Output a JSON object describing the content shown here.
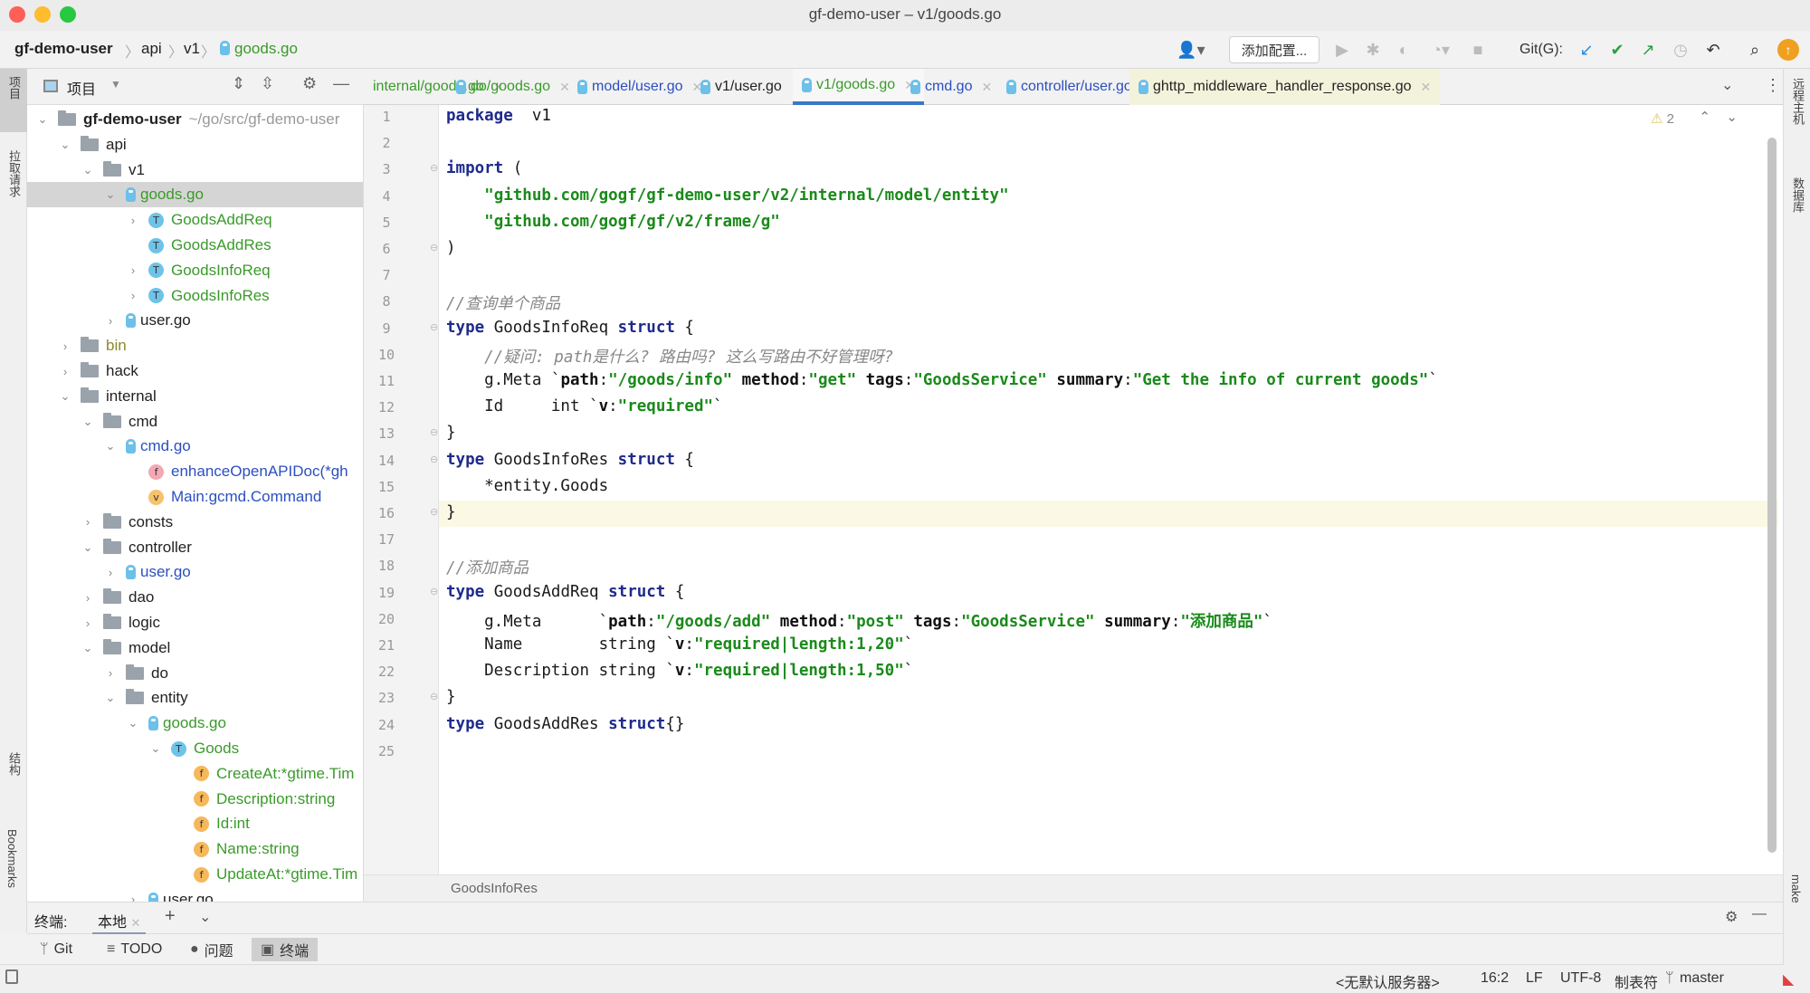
{
  "window": {
    "title": "gf-demo-user – v1/goods.go"
  },
  "navbar": {
    "breadcrumb": [
      "gf-demo-user",
      "api",
      "v1",
      "goods.go"
    ],
    "config_button": "添加配置...",
    "git_label": "Git(G):"
  },
  "left_strip": {
    "items": [
      "项目",
      "拉取请求",
      "结构",
      "Bookmarks"
    ]
  },
  "right_strip": {
    "items": [
      "远程主机",
      "数据库",
      "make"
    ]
  },
  "project": {
    "header_label": "项目",
    "tree": [
      {
        "depth": 0,
        "type": "folder",
        "expanded": true,
        "label": "gf-demo-user",
        "hint": "~/go/src/gf-demo-user",
        "bold": true
      },
      {
        "depth": 1,
        "type": "folder",
        "expanded": true,
        "label": "api"
      },
      {
        "depth": 2,
        "type": "folder",
        "expanded": true,
        "label": "v1"
      },
      {
        "depth": 3,
        "type": "gofile",
        "expanded": true,
        "label": "goods.go",
        "color": "green",
        "selected": true
      },
      {
        "depth": 4,
        "type": "T",
        "expanded": false,
        "label": "GoodsAddReq",
        "color": "green"
      },
      {
        "depth": 4,
        "type": "T",
        "label": "GoodsAddRes",
        "color": "green"
      },
      {
        "depth": 4,
        "type": "T",
        "expanded": false,
        "label": "GoodsInfoReq",
        "color": "green"
      },
      {
        "depth": 4,
        "type": "T",
        "expanded": false,
        "label": "GoodsInfoRes",
        "color": "green"
      },
      {
        "depth": 3,
        "type": "gofile",
        "expanded": false,
        "label": "user.go"
      },
      {
        "depth": 1,
        "type": "folder",
        "expanded": false,
        "label": "bin",
        "color": "olive"
      },
      {
        "depth": 1,
        "type": "folder",
        "expanded": false,
        "label": "hack"
      },
      {
        "depth": 1,
        "type": "folder",
        "expanded": true,
        "label": "internal"
      },
      {
        "depth": 2,
        "type": "folder",
        "expanded": true,
        "label": "cmd"
      },
      {
        "depth": 3,
        "type": "gofile",
        "expanded": true,
        "label": "cmd.go",
        "color": "blue"
      },
      {
        "depth": 4,
        "type": "f",
        "label": "enhanceOpenAPIDoc(*gh",
        "color": "blue"
      },
      {
        "depth": 4,
        "type": "v",
        "label": "Main:gcmd.Command",
        "color": "blue"
      },
      {
        "depth": 2,
        "type": "folder",
        "expanded": false,
        "label": "consts"
      },
      {
        "depth": 2,
        "type": "folder",
        "expanded": true,
        "label": "controller"
      },
      {
        "depth": 3,
        "type": "gofile",
        "expanded": false,
        "label": "user.go",
        "color": "blue"
      },
      {
        "depth": 2,
        "type": "folder",
        "expanded": false,
        "label": "dao"
      },
      {
        "depth": 2,
        "type": "folder",
        "expanded": false,
        "label": "logic"
      },
      {
        "depth": 2,
        "type": "folder",
        "expanded": true,
        "label": "model"
      },
      {
        "depth": 3,
        "type": "folder",
        "expanded": false,
        "label": "do"
      },
      {
        "depth": 3,
        "type": "folder",
        "expanded": true,
        "label": "entity"
      },
      {
        "depth": 4,
        "type": "gofile",
        "expanded": true,
        "label": "goods.go",
        "color": "green"
      },
      {
        "depth": 5,
        "type": "T",
        "expanded": true,
        "label": "Goods",
        "color": "green"
      },
      {
        "depth": 6,
        "type": "fo",
        "label": "CreateAt:*gtime.Tim",
        "color": "green"
      },
      {
        "depth": 6,
        "type": "fo",
        "label": "Description:string",
        "color": "green"
      },
      {
        "depth": 6,
        "type": "fo",
        "label": "Id:int",
        "color": "green"
      },
      {
        "depth": 6,
        "type": "fo",
        "label": "Name:string",
        "color": "green"
      },
      {
        "depth": 6,
        "type": "fo",
        "label": "UpdateAt:*gtime.Tim",
        "color": "green"
      },
      {
        "depth": 4,
        "type": "gofile",
        "expanded": false,
        "label": "user.go"
      }
    ]
  },
  "tabs": [
    {
      "label": "internal/goods.go",
      "color": "green",
      "icon": false
    },
    {
      "label": "do/goods.go",
      "color": "green",
      "icon": true
    },
    {
      "label": "model/user.go",
      "color": "blue",
      "icon": true
    },
    {
      "label": "v1/user.go",
      "color": "dark",
      "icon": true
    },
    {
      "label": "v1/goods.go",
      "color": "green",
      "icon": true,
      "active": true
    },
    {
      "label": "cmd.go",
      "color": "blue",
      "icon": true
    },
    {
      "label": "controller/user.go",
      "color": "blue",
      "icon": true
    },
    {
      "label": "ghttp_middleware_handler_response.go",
      "color": "dark",
      "icon": true,
      "highlight": true
    }
  ],
  "editor": {
    "warnings_count": "2",
    "current_line": 16,
    "lines": [
      [
        [
          "kw",
          "package"
        ],
        [
          "",
          "  v1"
        ]
      ],
      [],
      [
        [
          "kw",
          "import"
        ],
        [
          "",
          " ("
        ]
      ],
      [
        [
          "",
          "    "
        ],
        [
          "str",
          "\"github.com/gogf/gf-demo-user/v2/internal/model/entity\""
        ]
      ],
      [
        [
          "",
          "    "
        ],
        [
          "str",
          "\"github.com/gogf/gf/v2/frame/g\""
        ]
      ],
      [
        [
          "",
          ")"
        ]
      ],
      [],
      [
        [
          "cmt",
          "//查询单个商品"
        ]
      ],
      [
        [
          "kw",
          "type"
        ],
        [
          "",
          " GoodsInfoReq "
        ],
        [
          "kw",
          "struct"
        ],
        [
          "",
          " {"
        ]
      ],
      [
        [
          "cmt",
          "    //疑问: path是什么? 路由吗? 这么写路由不好管理呀?"
        ]
      ],
      [
        [
          "",
          "    g.Meta `"
        ],
        [
          "tagk",
          "path"
        ],
        [
          "",
          ":"
        ],
        [
          "str",
          "\"/goods/info\""
        ],
        [
          "tagk",
          " method"
        ],
        [
          "",
          ":"
        ],
        [
          "str",
          "\"get\""
        ],
        [
          "tagk",
          " tags"
        ],
        [
          "",
          ":"
        ],
        [
          "str",
          "\"GoodsService\""
        ],
        [
          "tagk",
          " summary"
        ],
        [
          "",
          ":"
        ],
        [
          "str",
          "\"Get the info of current goods\""
        ],
        [
          "",
          "`"
        ]
      ],
      [
        [
          "",
          "    Id     int `"
        ],
        [
          "tagk",
          "v"
        ],
        [
          "",
          ":"
        ],
        [
          "str",
          "\"required\""
        ],
        [
          "",
          "`"
        ]
      ],
      [
        [
          "",
          "}"
        ]
      ],
      [
        [
          "kw",
          "type"
        ],
        [
          "",
          " GoodsInfoRes "
        ],
        [
          "kw",
          "struct"
        ],
        [
          "",
          " {"
        ]
      ],
      [
        [
          "",
          "    *entity.Goods"
        ]
      ],
      [
        [
          "",
          "}"
        ]
      ],
      [],
      [
        [
          "cmt",
          "//添加商品"
        ]
      ],
      [
        [
          "kw",
          "type"
        ],
        [
          "",
          " GoodsAddReq "
        ],
        [
          "kw",
          "struct"
        ],
        [
          "",
          " {"
        ]
      ],
      [
        [
          "",
          "    g.Meta      `"
        ],
        [
          "tagk",
          "path"
        ],
        [
          "",
          ":"
        ],
        [
          "str",
          "\"/goods/add\""
        ],
        [
          "tagk",
          " method"
        ],
        [
          "",
          ":"
        ],
        [
          "str",
          "\"post\""
        ],
        [
          "tagk",
          " tags"
        ],
        [
          "",
          ":"
        ],
        [
          "str",
          "\"GoodsService\""
        ],
        [
          "tagk",
          " summary"
        ],
        [
          "",
          ":"
        ],
        [
          "str",
          "\"添加商品\""
        ],
        [
          "",
          "`"
        ]
      ],
      [
        [
          "",
          "    Name        string `"
        ],
        [
          "tagk",
          "v"
        ],
        [
          "",
          ":"
        ],
        [
          "str",
          "\"required|length:1,20\""
        ],
        [
          "",
          "`"
        ]
      ],
      [
        [
          "",
          "    Description string `"
        ],
        [
          "tagk",
          "v"
        ],
        [
          "",
          ":"
        ],
        [
          "str",
          "\"required|length:1,50\""
        ],
        [
          "",
          "`"
        ]
      ],
      [
        [
          "",
          "}"
        ]
      ],
      [
        [
          "kw",
          "type"
        ],
        [
          "",
          " GoodsAddRes "
        ],
        [
          "kw",
          "struct"
        ],
        [
          "",
          "{}"
        ]
      ],
      []
    ],
    "breadcrumb": "GoodsInfoRes"
  },
  "terminal": {
    "label": "终端:",
    "tab": "本地"
  },
  "tool_tabs": [
    {
      "icon": "git-icon",
      "label": "Git"
    },
    {
      "icon": "list-icon",
      "label": "TODO"
    },
    {
      "icon": "problem-icon",
      "label": "问题"
    },
    {
      "icon": "terminal-icon",
      "label": "终端",
      "active": true
    }
  ],
  "status": {
    "server": "<无默认服务器>",
    "position": "16:2",
    "line_sep": "LF",
    "encoding": "UTF-8",
    "indent": "制表符",
    "branch": "master"
  }
}
